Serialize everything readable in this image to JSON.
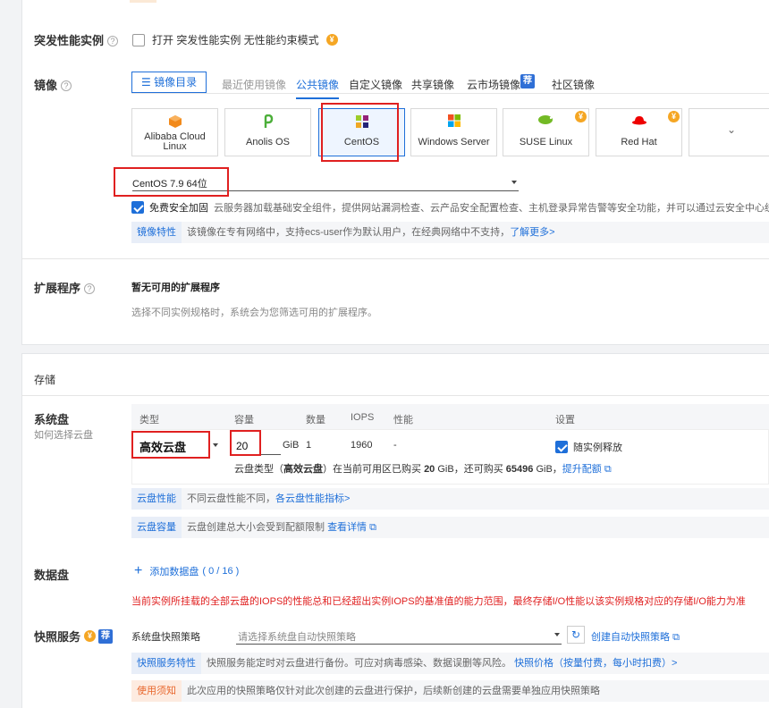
{
  "burst": {
    "label": "突发性能实例",
    "checkbox_text": "打开 突发性能实例 无性能约束模式"
  },
  "image": {
    "label": "镜像",
    "catalog_button": "镜像目录",
    "tabs": [
      "最近使用镜像",
      "公共镜像",
      "自定义镜像",
      "共享镜像",
      "云市场镜像",
      "社区镜像"
    ],
    "market_badge": "荐",
    "os_cards": [
      {
        "name": "Alibaba Cloud Linux",
        "icon": "alibaba-cloud-icon"
      },
      {
        "name": "Anolis OS",
        "icon": "anolis-icon"
      },
      {
        "name": "CentOS",
        "icon": "centos-icon"
      },
      {
        "name": "Windows Server",
        "icon": "windows-icon"
      },
      {
        "name": "SUSE Linux",
        "icon": "suse-icon"
      },
      {
        "name": "Red Hat",
        "icon": "redhat-icon"
      }
    ],
    "version": "CentOS 7.9 64位",
    "security_label": "免费安全加固",
    "security_desc": "云服务器加载基础安全组件，提供网站漏洞检查、云产品安全配置检查、主机登录异常告警等安全功能，并可以通过云安全中心统一管理",
    "feature_tag": "镜像特性",
    "feature_desc": "该镜像在专有网络中，支持ecs-user作为默认用户，在经典网络中不支持，",
    "feature_link": "了解更多>"
  },
  "extension": {
    "label": "扩展程序",
    "title": "暂无可用的扩展程序",
    "desc": "选择不同实例规格时，系统会为您筛选可用的扩展程序。"
  },
  "storage": {
    "section_title": "存储",
    "system_disk_label": "系统盘",
    "how_to_choose": "如何选择云盘",
    "headers": {
      "type": "类型",
      "capacity": "容量",
      "count": "数量",
      "iops": "IOPS",
      "perf": "性能",
      "settings": "设置"
    },
    "disk_type": "高效云盘",
    "capacity": "20",
    "unit": "GiB",
    "count": "1",
    "iops": "1960",
    "perf": "-",
    "release_label": "随实例释放",
    "quota_prefix": "云盘类型（",
    "quota_type": "高效云盘",
    "quota_mid": "）在当前可用区已购买",
    "quota_bought": "20",
    "quota_mid2": "GiB，还可购买",
    "quota_remain": "65496",
    "quota_unit": "GiB，",
    "quota_link": "提升配额",
    "perf_tag": "云盘性能",
    "perf_desc": "不同云盘性能不同，",
    "perf_link": "各云盘性能指标>",
    "cap_tag": "云盘容量",
    "cap_desc": "云盘创建总大小会受到配额限制",
    "cap_link": "查看详情"
  },
  "data_disk": {
    "label": "数据盘",
    "add_text": "添加数据盘",
    "count": "( 0 / 16 )",
    "warning": "当前实例所挂载的全部云盘的IOPS的性能总和已经超出实例IOPS的基准值的能力范围，最终存储I/O性能以该实例规格对应的存储I/O能力为准"
  },
  "snapshot": {
    "label": "快照服务",
    "badge": "荐",
    "policy_label": "系统盘快照策略",
    "policy_placeholder": "请选择系统盘自动快照策略",
    "create_link": "创建自动快照策略",
    "feature_tag": "快照服务特性",
    "feature_desc": "快照服务能定时对云盘进行备份。可应对病毒感染、数据误删等风险。",
    "price_link": "快照价格（按量付费，每小时扣费）>",
    "notice_tag": "使用须知",
    "notice_desc": "此次应用的快照策略仅针对此次创建的云盘进行保护，后续新创建的云盘需要单独应用快照策略"
  },
  "colors": {
    "accent": "#1e6fd9",
    "warning": "#e02020",
    "coin": "#f5a623"
  }
}
